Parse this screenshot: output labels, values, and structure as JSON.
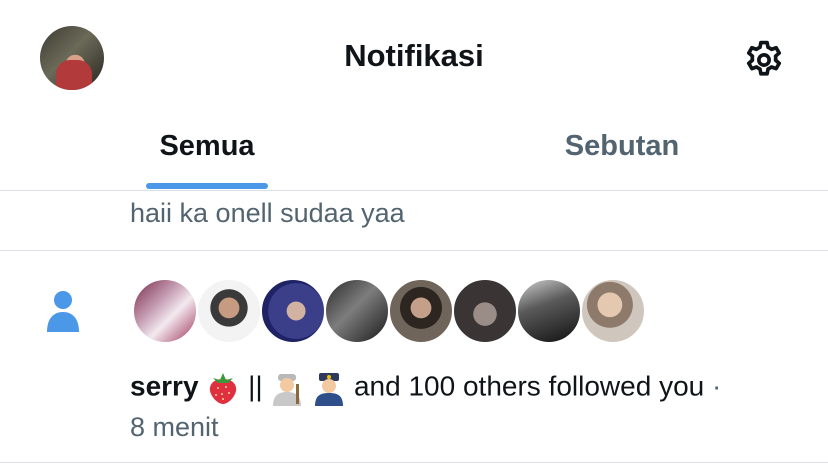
{
  "header": {
    "title": "Notifikasi"
  },
  "tabs": [
    {
      "label": "Semua"
    },
    {
      "label": "Sebutan"
    }
  ],
  "previous_item": {
    "text": "haii ka onell sudaa yaa"
  },
  "follow_notification": {
    "name": "serry",
    "separator": "||",
    "message": "and 100 others followed you",
    "dot": "·",
    "time": "8 menit"
  }
}
